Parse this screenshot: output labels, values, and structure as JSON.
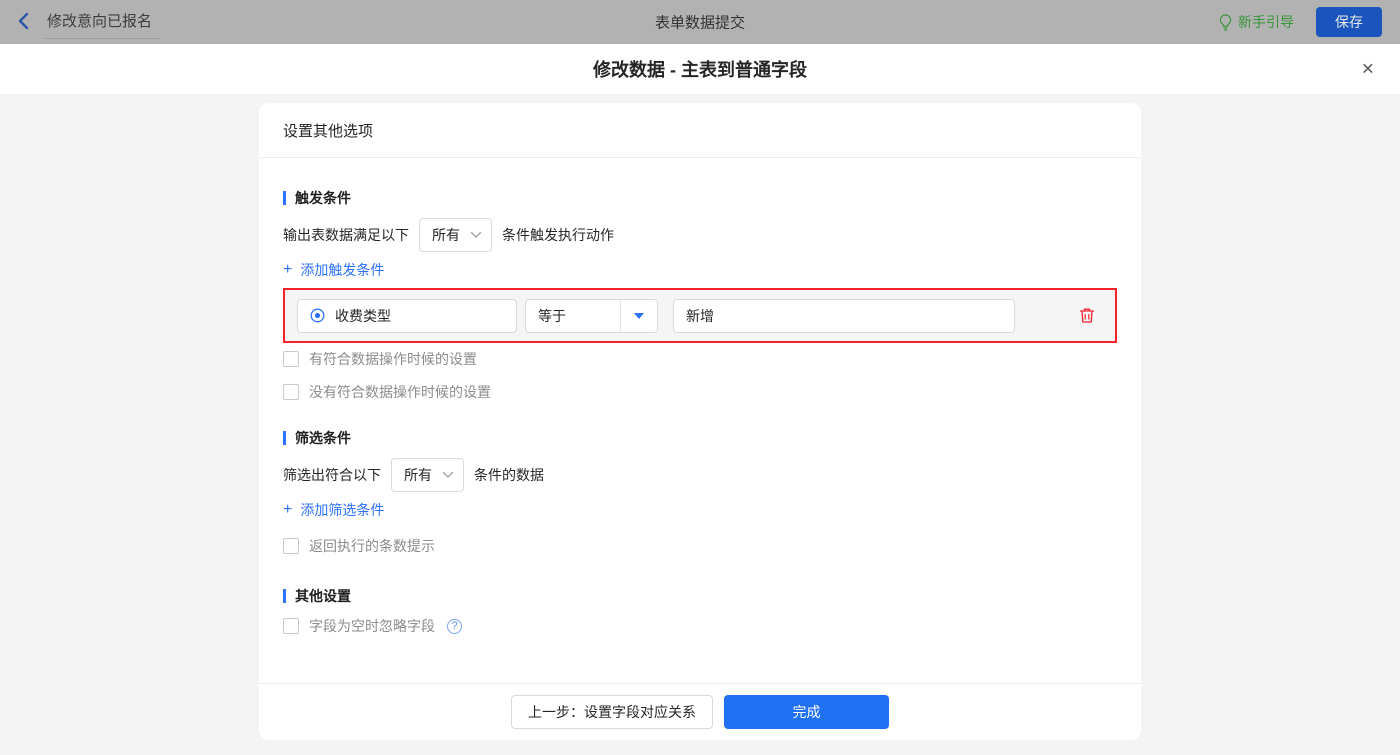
{
  "topbar": {
    "back": "修改意向已报名",
    "title": "表单数据提交",
    "guide": "新手引导",
    "save": "保存"
  },
  "modal": {
    "title": "修改数据 - 主表到普通字段"
  },
  "panel": {
    "header": "设置其他选项"
  },
  "trigger": {
    "title": "触发条件",
    "prefix": "输出表数据满足以下",
    "mode": "所有",
    "suffix": "条件触发执行动作",
    "add": "添加触发条件",
    "row": {
      "field": "收费类型",
      "operator": "等于",
      "value": "新增"
    },
    "opt_has": "有符合数据操作时候的设置",
    "opt_none": "没有符合数据操作时候的设置"
  },
  "filter": {
    "title": "筛选条件",
    "prefix": "筛选出符合以下",
    "mode": "所有",
    "suffix": "条件的数据",
    "add": "添加筛选条件",
    "opt_count": "返回执行的条数提示"
  },
  "other": {
    "title": "其他设置",
    "opt_ignore": "字段为空时忽略字段"
  },
  "footer": {
    "prev": "上一步：设置字段对应关系",
    "done": "完成"
  },
  "icons": {
    "plus": "+",
    "close": "×",
    "help": "?"
  },
  "colors": {
    "accent": "#2e73ff",
    "danger": "#f5222d",
    "guide_green": "#37953a"
  }
}
